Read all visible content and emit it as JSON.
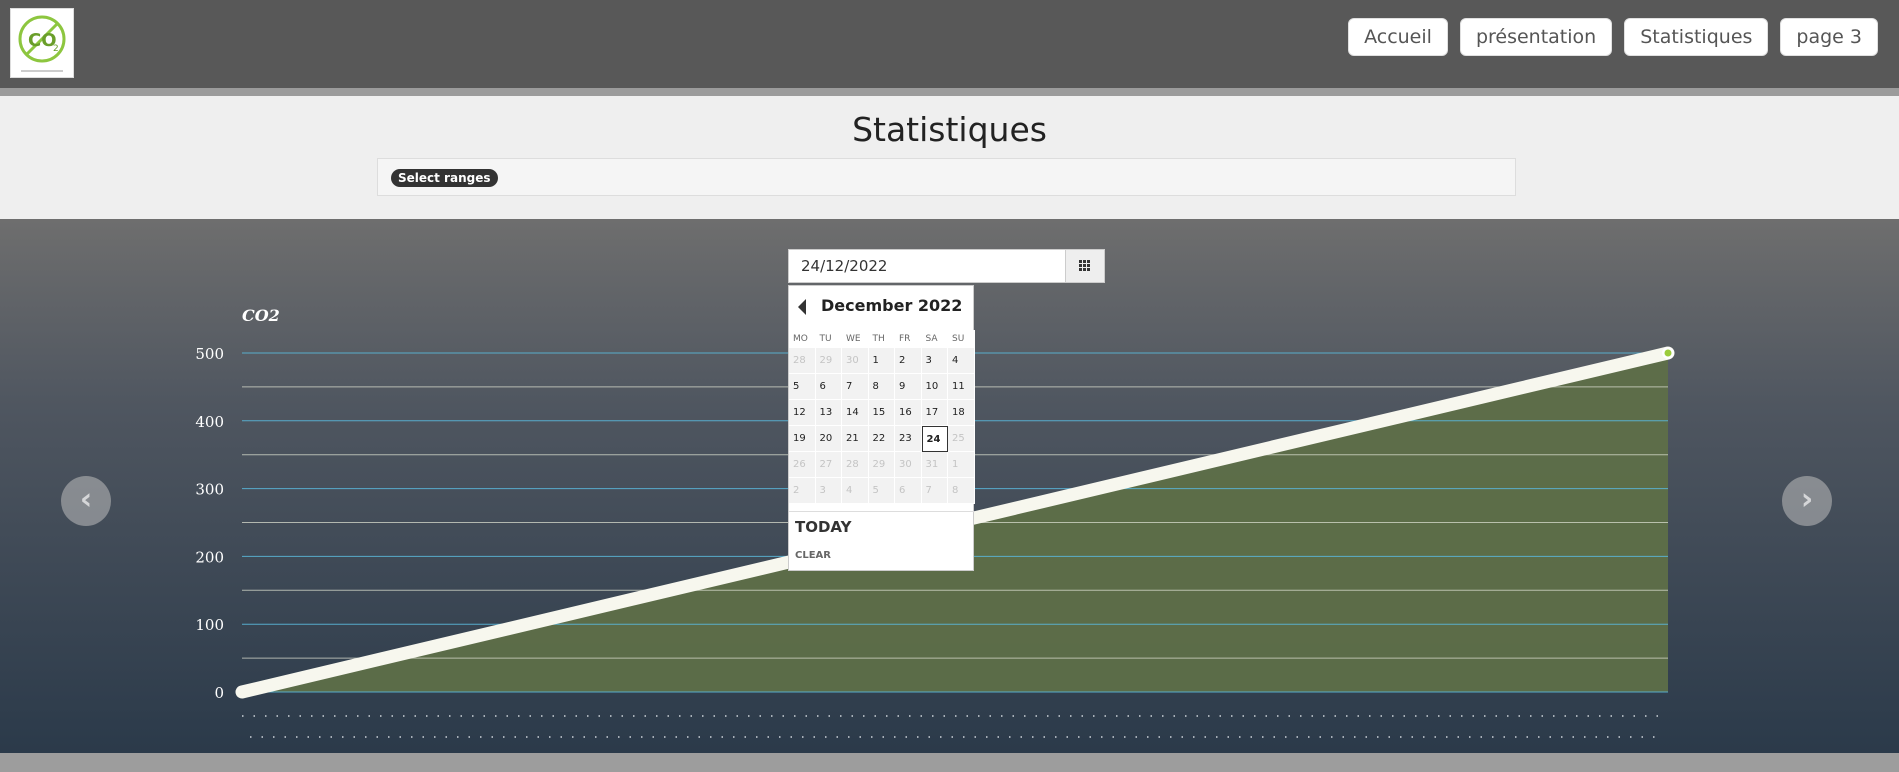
{
  "nav": {
    "items": [
      {
        "label": "Accueil"
      },
      {
        "label": "présentation"
      },
      {
        "label": "Statistiques"
      },
      {
        "label": "page 3"
      }
    ]
  },
  "logo": {
    "text": "CO2",
    "caption": "ensemble pour un avenir vert",
    "accent": "#8dc63f"
  },
  "page": {
    "title": "Statistiques",
    "ranges_label": "Select ranges"
  },
  "datepicker": {
    "value": "24/12/2022",
    "month_label": "December 2022",
    "weekdays": [
      "MO",
      "TU",
      "WE",
      "TH",
      "FR",
      "SA",
      "SU"
    ],
    "weeks": [
      [
        {
          "d": "28",
          "m": true
        },
        {
          "d": "29",
          "m": true
        },
        {
          "d": "30",
          "m": true
        },
        {
          "d": "1"
        },
        {
          "d": "2"
        },
        {
          "d": "3"
        },
        {
          "d": "4"
        }
      ],
      [
        {
          "d": "5"
        },
        {
          "d": "6"
        },
        {
          "d": "7"
        },
        {
          "d": "8"
        },
        {
          "d": "9"
        },
        {
          "d": "10"
        },
        {
          "d": "11"
        }
      ],
      [
        {
          "d": "12"
        },
        {
          "d": "13"
        },
        {
          "d": "14"
        },
        {
          "d": "15"
        },
        {
          "d": "16"
        },
        {
          "d": "17"
        },
        {
          "d": "18"
        }
      ],
      [
        {
          "d": "19"
        },
        {
          "d": "20"
        },
        {
          "d": "21"
        },
        {
          "d": "22"
        },
        {
          "d": "23"
        },
        {
          "d": "24",
          "s": true
        },
        {
          "d": "25",
          "m": true
        }
      ],
      [
        {
          "d": "26",
          "m": true
        },
        {
          "d": "27",
          "m": true
        },
        {
          "d": "28",
          "m": true
        },
        {
          "d": "29",
          "m": true
        },
        {
          "d": "30",
          "m": true
        },
        {
          "d": "31",
          "m": true
        },
        {
          "d": "1",
          "m": true
        }
      ],
      [
        {
          "d": "2",
          "m": true
        },
        {
          "d": "3",
          "m": true
        },
        {
          "d": "4",
          "m": true
        },
        {
          "d": "5",
          "m": true
        },
        {
          "d": "6",
          "m": true
        },
        {
          "d": "7",
          "m": true
        },
        {
          "d": "8",
          "m": true
        }
      ]
    ],
    "today_label": "TODAY",
    "clear_label": "CLEAR"
  },
  "carousel": {
    "prev_icon": "chevron-left-icon",
    "next_icon": "chevron-right-icon"
  },
  "chart_data": {
    "type": "area",
    "title": "CO2",
    "ylabel": "",
    "xlabel": "",
    "ylim": [
      0,
      500
    ],
    "yticks": [
      0,
      100,
      200,
      300,
      400,
      500
    ],
    "x": [
      0,
      1
    ],
    "series": [
      {
        "values": [
          0,
          500
        ]
      }
    ],
    "grid": true,
    "colors": {
      "fill": "#5e6f48",
      "line": "#f7f7ee",
      "grid": "#5ab6d8",
      "point": "#9ccc3c"
    }
  }
}
